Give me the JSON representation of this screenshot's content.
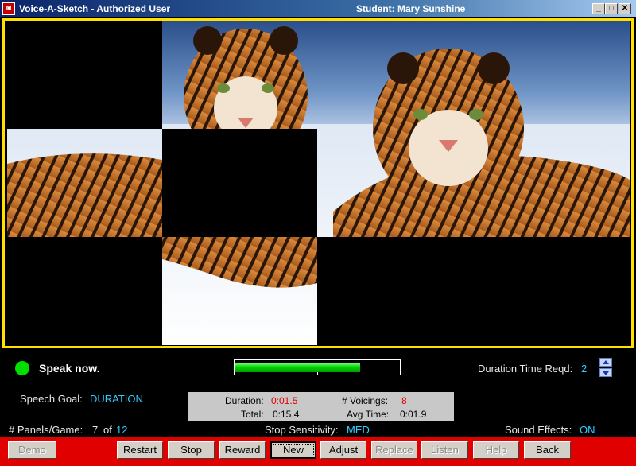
{
  "window": {
    "title": "Voice-A-Sketch - Authorized User",
    "student": "Student:  Mary Sunshine",
    "controls": [
      "_",
      "□",
      "✕"
    ]
  },
  "status": {
    "speak_text": "Speak now.",
    "indicator_color": "#00e000",
    "meter_level": 0.76
  },
  "duration_time": {
    "label": "Duration Time Reqd:",
    "value": "2"
  },
  "speech_goal": {
    "label": "Speech Goal:",
    "value": "DURATION"
  },
  "stats": {
    "duration_label": "Duration:",
    "duration_value": "0:01.5",
    "voicings_label": "# Voicings:",
    "voicings_value": "8",
    "total_label": "Total:",
    "total_value": "0:15.4",
    "avg_label": "Avg Time:",
    "avg_value": "0:01.9"
  },
  "panels": {
    "label": "# Panels/Game:",
    "current": "7",
    "of": "of",
    "total": "12"
  },
  "stop_sensitivity": {
    "label": "Stop  Sensitivity:",
    "value": "MED"
  },
  "sound_effects": {
    "label": "Sound  Effects:",
    "value": "ON"
  },
  "buttons": {
    "demo": "Demo",
    "restart": "Restart",
    "stop": "Stop",
    "reward": "Reward",
    "new": "New",
    "adjust": "Adjust",
    "replace": "Replace",
    "listen": "Listen",
    "help": "Help",
    "back": "Back"
  },
  "colors": {
    "accent_cyan": "#33ccff",
    "value_red": "#e00000",
    "border_yellow": "#ffe000",
    "toolbar_red": "#e00000"
  }
}
